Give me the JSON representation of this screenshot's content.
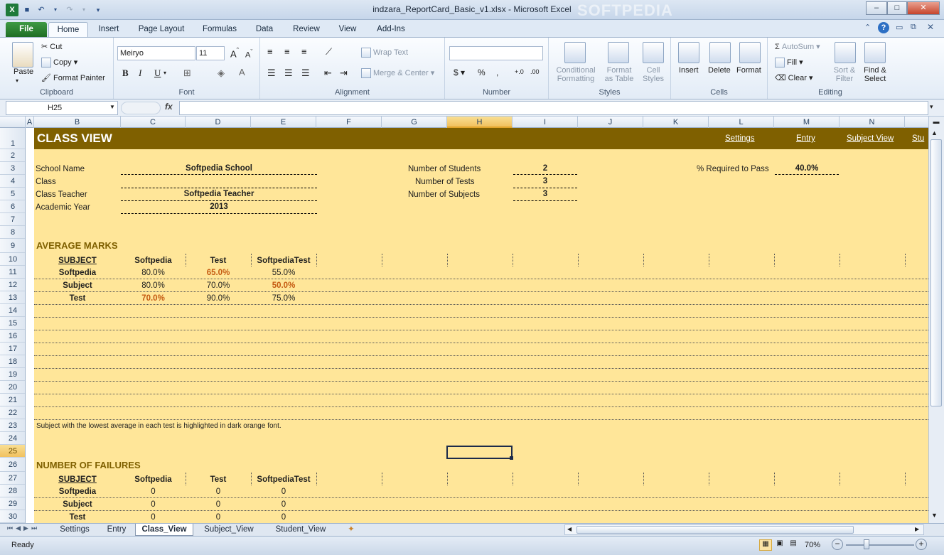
{
  "window": {
    "title": "indzara_ReportCard_Basic_v1.xlsx  -  Microsoft Excel",
    "watermark": "SOFTPEDIA"
  },
  "ribbon_tabs": [
    "File",
    "Home",
    "Insert",
    "Page Layout",
    "Formulas",
    "Data",
    "Review",
    "View",
    "Add-Ins"
  ],
  "ribbon": {
    "clipboard": {
      "paste": "Paste",
      "cut": "Cut",
      "copy": "Copy",
      "format_painter": "Format Painter",
      "label": "Clipboard"
    },
    "font": {
      "name": "Meiryo",
      "size": "11",
      "label": "Font"
    },
    "alignment": {
      "wrap": "Wrap Text",
      "merge": "Merge & Center",
      "label": "Alignment"
    },
    "number": {
      "label": "Number"
    },
    "styles": {
      "cond1": "Conditional",
      "cond2": "Formatting",
      "fmt1": "Format",
      "fmt2": "as Table",
      "cell1": "Cell",
      "cell2": "Styles",
      "label": "Styles"
    },
    "cells": {
      "insert": "Insert",
      "delete": "Delete",
      "format": "Format",
      "label": "Cells"
    },
    "editing": {
      "autosum": "AutoSum",
      "fill": "Fill",
      "clear": "Clear",
      "sort1": "Sort &",
      "sort2": "Filter",
      "find1": "Find &",
      "find2": "Select",
      "label": "Editing"
    }
  },
  "formula_bar": {
    "name_box": "H25",
    "fx": "fx",
    "value": ""
  },
  "columns": [
    "A",
    "B",
    "C",
    "D",
    "E",
    "F",
    "G",
    "H",
    "I",
    "J",
    "K",
    "L",
    "M",
    "N"
  ],
  "rows": [
    "1",
    "2",
    "3",
    "4",
    "5",
    "6",
    "7",
    "8",
    "9",
    "10",
    "11",
    "12",
    "13",
    "14",
    "15",
    "16",
    "17",
    "18",
    "19",
    "20",
    "21",
    "22",
    "23",
    "25",
    "24",
    "26",
    "27",
    "28",
    "29",
    "30"
  ],
  "sheet": {
    "banner_title": "CLASS VIEW",
    "nav_links": [
      "Settings",
      "Entry",
      "Subject View",
      "Stu"
    ],
    "info": {
      "school_name_label": "School Name",
      "school_name": "Softpedia School",
      "class_label": "Class",
      "class": "",
      "teacher_label": "Class Teacher",
      "teacher": "Softpedia Teacher",
      "year_label": "Academic Year",
      "year": "2013",
      "students_label": "Number of Students",
      "students": "2",
      "tests_label": "Number of Tests",
      "tests": "3",
      "subjects_label": "Number of Subjects",
      "subjects": "3",
      "pass_label": "% Required to Pass",
      "pass": "40.0%"
    },
    "avg": {
      "title": "AVERAGE MARKS",
      "headers": [
        "SUBJECT",
        "Softpedia",
        "Test",
        "SoftpediaTest"
      ],
      "rows": [
        [
          "Softpedia",
          "80.0%",
          "65.0%",
          "55.0%"
        ],
        [
          "Subject",
          "80.0%",
          "70.0%",
          "50.0%"
        ],
        [
          "Test",
          "70.0%",
          "90.0%",
          "75.0%"
        ]
      ]
    },
    "note": "Subject with the lowest average in each test is highlighted in dark orange font.",
    "fail": {
      "title": "NUMBER OF FAILURES",
      "headers": [
        "SUBJECT",
        "Softpedia",
        "Test",
        "SoftpediaTest"
      ],
      "rows": [
        [
          "Softpedia",
          "0",
          "0",
          "0"
        ],
        [
          "Subject",
          "0",
          "0",
          "0"
        ],
        [
          "Test",
          "0",
          "0",
          "0"
        ]
      ]
    }
  },
  "sheet_tabs": [
    "Settings",
    "Entry",
    "Class_View",
    "Subject_View",
    "Student_View"
  ],
  "status": {
    "ready": "Ready",
    "zoom": "70%"
  }
}
